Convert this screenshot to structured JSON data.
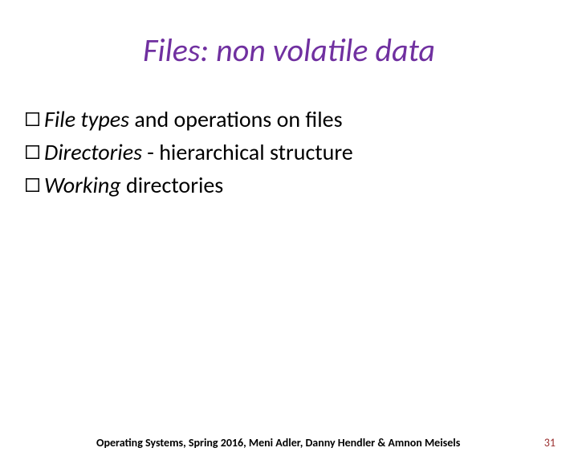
{
  "title": "Files:  non volatile data",
  "bullets": [
    {
      "italic": "File types",
      "rest": " and operations on files"
    },
    {
      "italic": "Directories",
      "rest": " - hierarchical structure"
    },
    {
      "italic": "Working",
      "rest": " directories"
    }
  ],
  "footer": "Operating Systems, Spring 2016, Meni Adler, Danny Hendler & Amnon Meisels",
  "pageNumber": "31",
  "colors": {
    "titleColor": "#7030a0",
    "pageNumColor": "#9a2e2e"
  }
}
